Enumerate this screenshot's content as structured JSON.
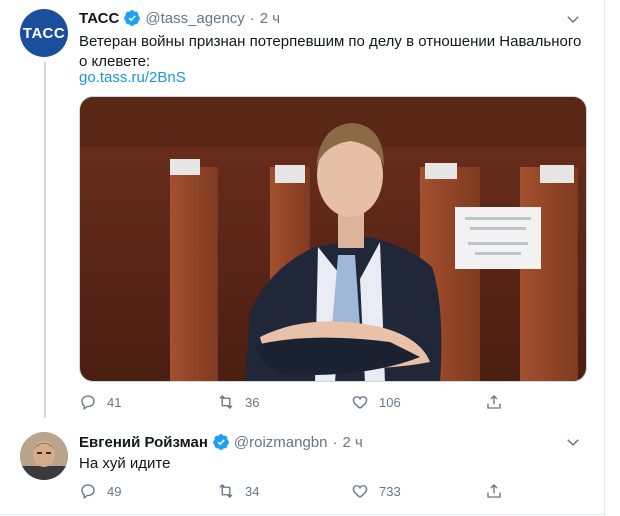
{
  "tweets": [
    {
      "avatar_text": "ТАСС",
      "name": "ТАСС",
      "handle": "@tass_agency",
      "separator": "·",
      "time": "2 ч",
      "text_line1": "Ветеран войны признан потерпевшим по делу в отношении Навального",
      "text_line2": "о клевете:",
      "link": "go.tass.ru/2BnS",
      "replies": "41",
      "retweets": "36",
      "likes": "106"
    },
    {
      "name": "Евгений Ройзман",
      "handle": "@roizmangbn",
      "separator": "·",
      "time": "2 ч",
      "text": "На хуй идите",
      "replies": "49",
      "retweets": "34",
      "likes": "733"
    }
  ],
  "icons": {
    "verified": "verified-badge-icon",
    "caret": "chevron-down-icon",
    "reply": "reply-icon",
    "retweet": "retweet-icon",
    "like": "heart-icon",
    "share": "share-icon"
  },
  "colors": {
    "accent": "#1b95e0",
    "muted": "#657786",
    "tass_brand": "#1b4f9c"
  }
}
